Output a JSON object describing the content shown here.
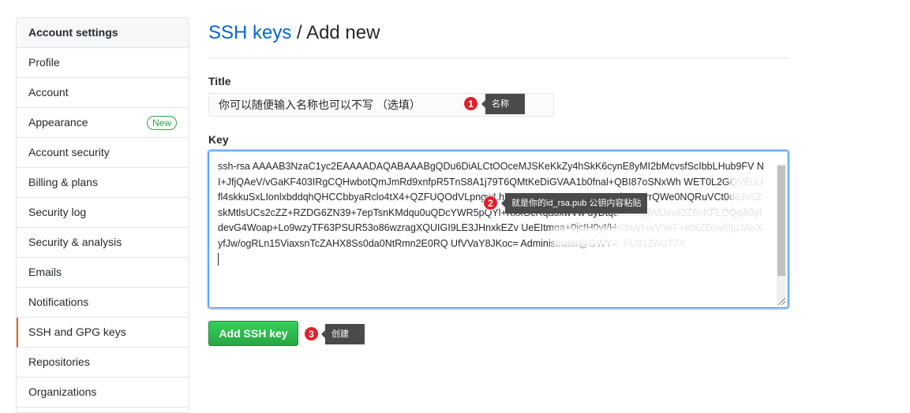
{
  "sidebar": {
    "header": "Account settings",
    "items": [
      {
        "label": "Profile"
      },
      {
        "label": "Account"
      },
      {
        "label": "Appearance",
        "badge": "New"
      },
      {
        "label": "Account security"
      },
      {
        "label": "Billing & plans"
      },
      {
        "label": "Security log"
      },
      {
        "label": "Security & analysis"
      },
      {
        "label": "Emails"
      },
      {
        "label": "Notifications"
      },
      {
        "label": "SSH and GPG keys",
        "selected": true
      },
      {
        "label": "Repositories"
      },
      {
        "label": "Organizations"
      }
    ]
  },
  "header": {
    "breadcrumb_link": "SSH keys",
    "separator": "/",
    "current": "Add new"
  },
  "form": {
    "title_label": "Title",
    "title_value": "你可以随便输入名称也可以不写 （选填）",
    "key_label": "Key",
    "key_value": "ssh-rsa AAAAB3NzaC1yc2EAAAADAQABAAABgQDu6DiALCtOOceMJSKeKkZy4hSkK6cynE8yMI2bMcvsfScIbbLHub9FV NI+JfjQAeV/vGaKF403IRgCQHwbotQmJmRd9xnfpR5TnS8A1j79T6QMtKeDiGVAA1b0fnal+QBI87oSNxWh WET0L2GQVEuUfl4skkuSxLIonlxbddqhQHCCbbyaRclo4tX4+QZFUQOdVLpngwLhUG7XcyE+OVnWx3BzCGfC 0mrrQWe0NQRuVCt0d8Jv5ZskMtlsUCs2cZZ+RZDG6ZN39+7epTsnKMdqu0uQDcYWR5pQYl+KxxOcRqaoxwVw uyDtqBa0anpjWUewi2Z6nKFLQQqA0yIdevG4Woap+Lo9wzyTF63PSUR53o86wzragXQUIGI9LE3JHnxkEZv UeEItmqa+0jcIH0yI/Ho3niVI+vVYeF+etXZDIw/0IpJAaXyfJw/ogRLn15ViaxsnTcZAHX8Ss0da0NtRmn2E0RQ UfVVaY8JKoc= Administrator@GWY4FFU81ZAUT7X",
    "submit_label": "Add SSH key"
  },
  "annotations": [
    {
      "number": "1",
      "text": "名称"
    },
    {
      "number": "2",
      "text": "就是你的id_rsa.pub 公钥内容粘贴"
    },
    {
      "number": "3",
      "text": "创建"
    }
  ],
  "colors": {
    "link": "#0366d6",
    "primary_button": "#28a745",
    "badge_new": "#28a745",
    "selected_indicator": "#e36209",
    "annotation_badge": "#e0212b",
    "annotation_tip": "#4a4a4a"
  }
}
